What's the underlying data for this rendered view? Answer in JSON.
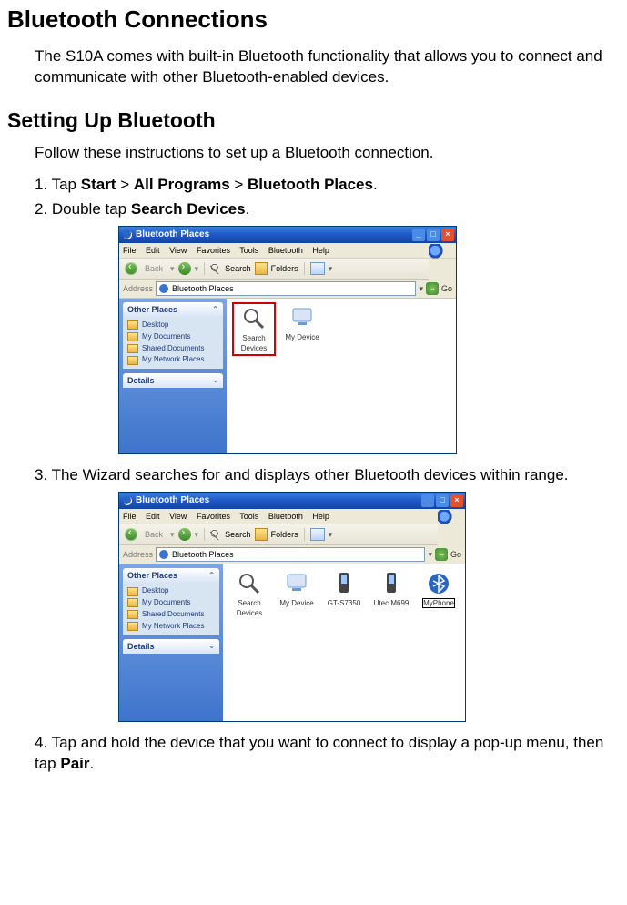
{
  "h1": "Bluetooth Connections",
  "intro": "The S10A comes with built-in Bluetooth functionality that allows you to connect and communicate with other Bluetooth-enabled devices.",
  "h2": "Setting Up Bluetooth",
  "sub": "Follow these instructions to set up a Bluetooth connection.",
  "steps": {
    "s1": {
      "p1": "1. Tap ",
      "b1": "Start",
      "p2": " > ",
      "b2": "All Programs",
      "p3": " > ",
      "b3": "Bluetooth Places",
      "p4": "."
    },
    "s2": {
      "p1": "2. Double tap ",
      "b1": "Search Devices",
      "p2": "."
    },
    "s3": "3. The Wizard searches for and displays other Bluetooth devices within range.",
    "s4": {
      "p1": "4. Tap and hold the device that you want to connect to display a pop-up menu, then tap ",
      "b1": "Pair",
      "p2": "."
    }
  },
  "win": {
    "title": "Bluetooth Places",
    "menus": [
      "File",
      "Edit",
      "View",
      "Favorites",
      "Tools",
      "Bluetooth",
      "Help"
    ],
    "toolbar": {
      "back": "Back",
      "search": "Search",
      "folders": "Folders"
    },
    "address_label": "Address",
    "address_value": "Bluetooth Places",
    "go": "Go",
    "sidebar": {
      "panel1": {
        "title": "Other Places",
        "items": [
          "Desktop",
          "My Documents",
          "Shared Documents",
          "My Network Places"
        ]
      },
      "panel2": {
        "title": "Details"
      }
    },
    "devices1": [
      {
        "name": "Search Devices",
        "type": "search",
        "highlight": "red"
      },
      {
        "name": "My Device",
        "type": "my"
      }
    ],
    "devices2": [
      {
        "name": "Search Devices",
        "type": "search"
      },
      {
        "name": "My Device",
        "type": "my"
      },
      {
        "name": "GT-S7350",
        "type": "phone"
      },
      {
        "name": "Utec M699",
        "type": "phone"
      },
      {
        "name": "MyPhone",
        "type": "generic",
        "highlight": "black"
      }
    ]
  }
}
